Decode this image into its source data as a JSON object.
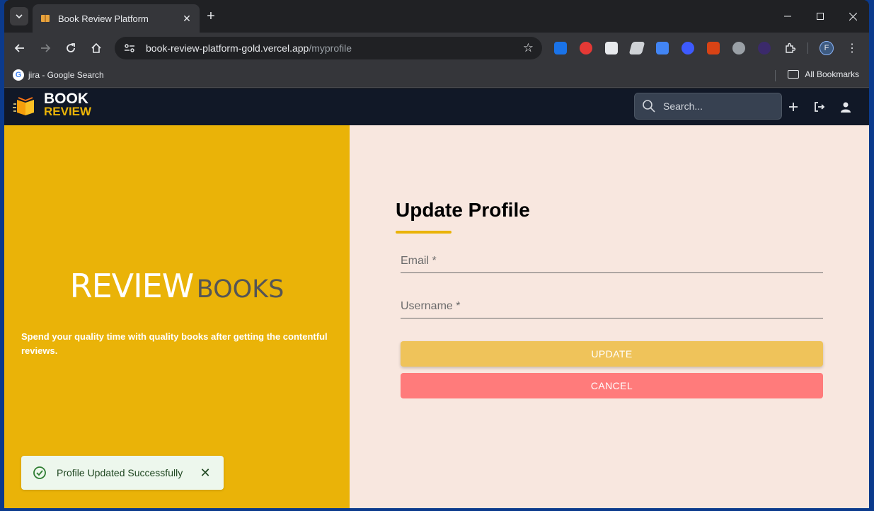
{
  "browser": {
    "tab_title": "Book Review Platform",
    "url_host": "book-review-platform-gold.vercel.app",
    "url_path": "/myprofile",
    "bookmark": "jira - Google Search",
    "all_bookmarks": "All Bookmarks",
    "profile_initial": "F"
  },
  "app": {
    "logo_top": "BOOK",
    "logo_bottom": "REVIEW",
    "search_placeholder": "Search...",
    "accent": "#eab308"
  },
  "hero": {
    "review": "REVIEW",
    "books": "BOOKS",
    "tagline": "Spend your quality time with quality books after getting the contentful reviews."
  },
  "form": {
    "title": "Update Profile",
    "email_label": "Email *",
    "username_label": "Username *",
    "update_label": "UPDATE",
    "cancel_label": "CANCEL"
  },
  "toast": {
    "message": "Profile Updated Successfully"
  }
}
